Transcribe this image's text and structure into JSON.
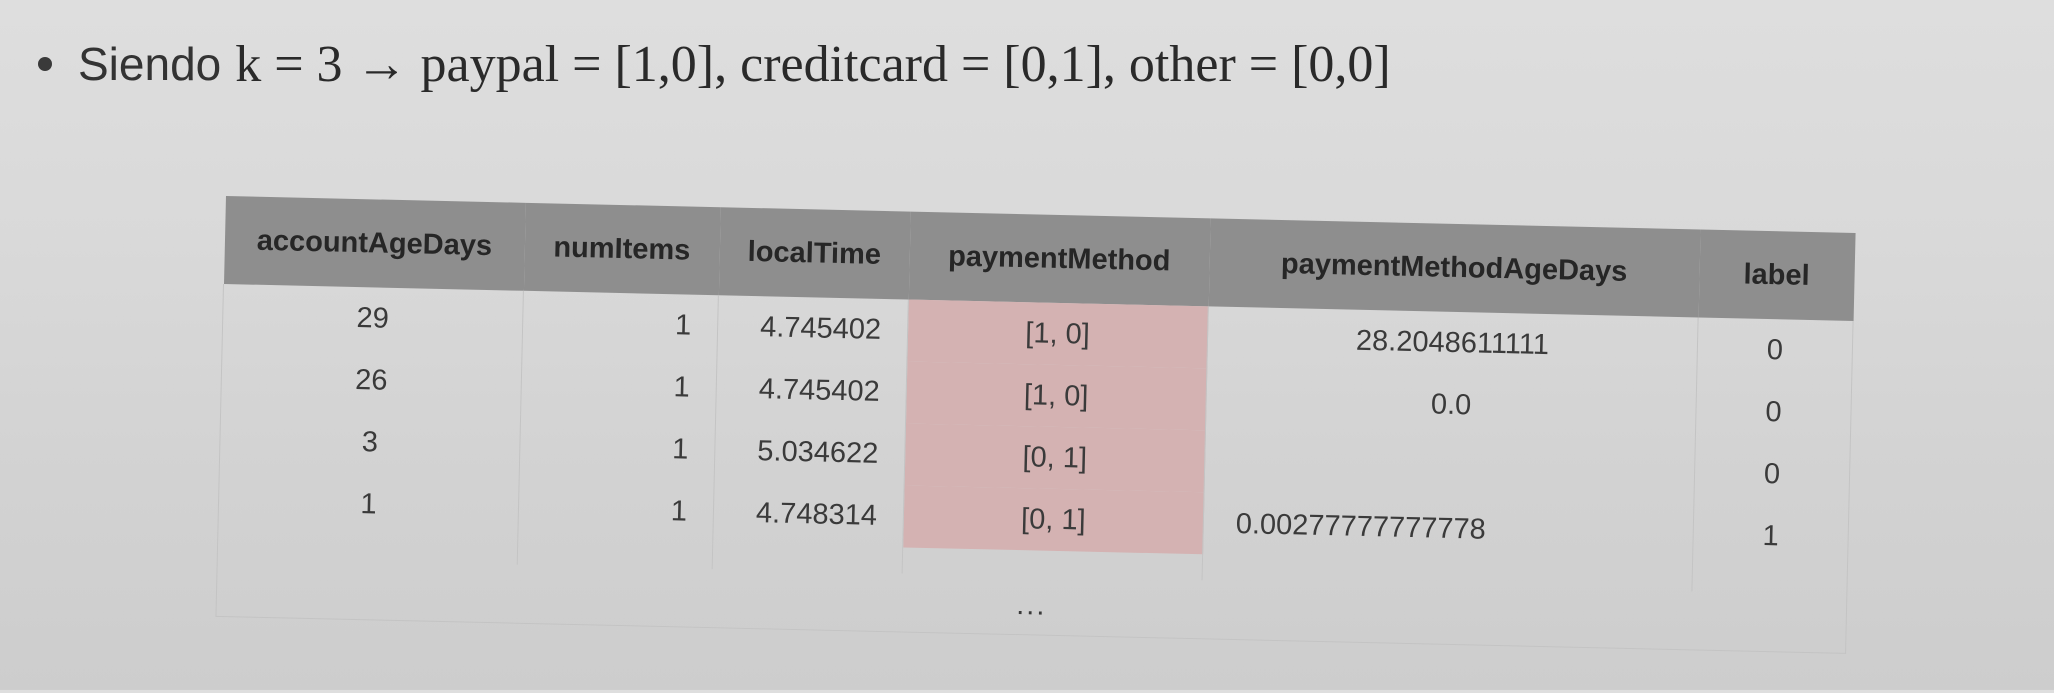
{
  "bullet": {
    "intro": "Siendo",
    "formula": "k = 3 → paypal = [1,0], creditcard = [0,1], other = [0,0]"
  },
  "table": {
    "headers": [
      "accountAgeDays",
      "numItems",
      "localTime",
      "paymentMethod",
      "paymentMethodAgeDays",
      "label"
    ],
    "rows": [
      [
        "29",
        "1",
        "4.745402",
        "[1, 0]",
        "28.2048611111",
        "0"
      ],
      [
        "26",
        "1",
        "4.745402",
        "[1, 0]",
        "0.0",
        "0"
      ],
      [
        "3",
        "1",
        "5.034622",
        "[0, 1]",
        "",
        "0"
      ],
      [
        "1",
        "1",
        "4.748314",
        "[0, 1]",
        "0.00277777777778",
        "1"
      ]
    ],
    "ellipsis": "..."
  },
  "colors": {
    "header_background": "#8e8e8e",
    "highlight_column": "#d4b2b2",
    "page_background": "#d9d9d9"
  }
}
